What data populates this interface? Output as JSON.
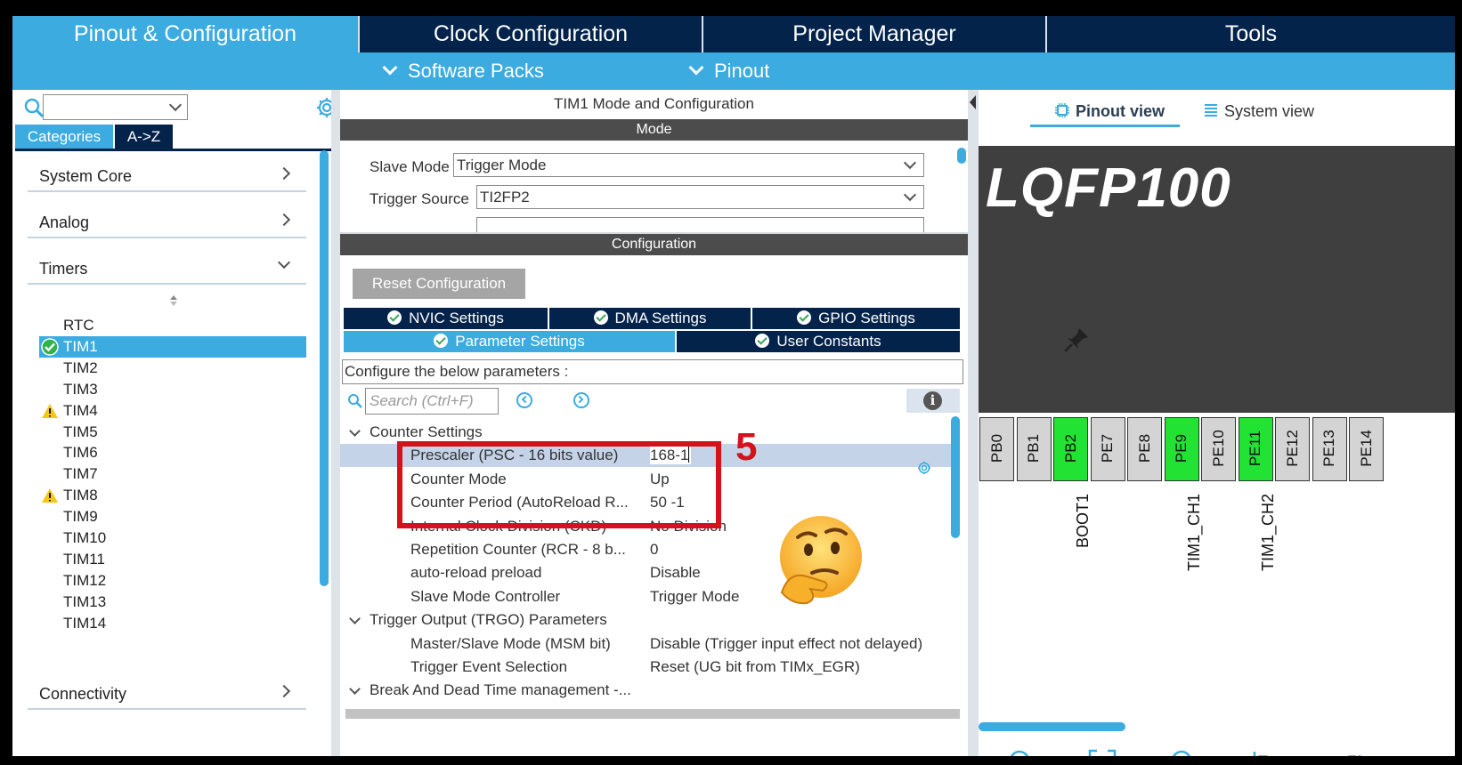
{
  "tabs": {
    "pinout_config": "Pinout & Configuration",
    "clock_config": "Clock Configuration",
    "project_manager": "Project Manager",
    "tools": "Tools"
  },
  "subbar": {
    "software_packs": "Software Packs",
    "pinout": "Pinout"
  },
  "left": {
    "search_value": "",
    "categories_tab": "Categories",
    "az_tab": "A->Z",
    "categories": [
      "System Core",
      "Analog",
      "Timers",
      "Connectivity"
    ],
    "timers": [
      {
        "label": "RTC",
        "status": "none"
      },
      {
        "label": "TIM1",
        "status": "ok",
        "selected": true
      },
      {
        "label": "TIM2",
        "status": "none"
      },
      {
        "label": "TIM3",
        "status": "none"
      },
      {
        "label": "TIM4",
        "status": "warning"
      },
      {
        "label": "TIM5",
        "status": "none"
      },
      {
        "label": "TIM6",
        "status": "none"
      },
      {
        "label": "TIM7",
        "status": "none"
      },
      {
        "label": "TIM8",
        "status": "warning"
      },
      {
        "label": "TIM9",
        "status": "none"
      },
      {
        "label": "TIM10",
        "status": "none"
      },
      {
        "label": "TIM11",
        "status": "none"
      },
      {
        "label": "TIM12",
        "status": "none"
      },
      {
        "label": "TIM13",
        "status": "none"
      },
      {
        "label": "TIM14",
        "status": "none"
      }
    ]
  },
  "middle": {
    "title": "TIM1 Mode and Configuration",
    "mode_header": "Mode",
    "slave_mode_label": "Slave Mode",
    "slave_mode_value": "Trigger Mode",
    "trigger_source_label": "Trigger Source",
    "trigger_source_value": "TI2FP2",
    "config_header": "Configuration",
    "reset_button": "Reset Configuration",
    "tabs_row1": [
      "NVIC Settings",
      "DMA Settings",
      "GPIO Settings"
    ],
    "tabs_row2": [
      "Parameter Settings",
      "User Constants"
    ],
    "configure_text": "Configure the below parameters :",
    "search_placeholder": "Search (Ctrl+F)",
    "rows": [
      {
        "type": "header",
        "key": "Counter Settings"
      },
      {
        "key": "Prescaler (PSC - 16 bits value)",
        "value": "168-1",
        "selected": true
      },
      {
        "key": "Counter Mode",
        "value": "Up"
      },
      {
        "key": "Counter Period (AutoReload R...",
        "value": "50 -1"
      },
      {
        "key": "Internal Clock Division (CKD)",
        "value": "No Division"
      },
      {
        "key": "Repetition Counter (RCR - 8 b...",
        "value": "0"
      },
      {
        "key": "auto-reload preload",
        "value": "Disable"
      },
      {
        "key": "Slave Mode Controller",
        "value": "Trigger Mode"
      },
      {
        "type": "header",
        "key": "Trigger Output (TRGO) Parameters"
      },
      {
        "key": "Master/Slave Mode (MSM bit)",
        "value": "Disable (Trigger input effect not delayed)"
      },
      {
        "key": "Trigger Event Selection",
        "value": "Reset (UG bit from TIMx_EGR)"
      },
      {
        "type": "header",
        "key": "Break And Dead Time management -..."
      }
    ]
  },
  "annotation": {
    "step": "5"
  },
  "right": {
    "pinout_view": "Pinout view",
    "system_view": "System view",
    "chip_name": "LQFP100",
    "pins": [
      {
        "name": "PB0",
        "active": false
      },
      {
        "name": "PB1",
        "active": false
      },
      {
        "name": "PB2",
        "active": true
      },
      {
        "name": "PE7",
        "active": false
      },
      {
        "name": "PE8",
        "active": false
      },
      {
        "name": "PE9",
        "active": true
      },
      {
        "name": "PE10",
        "active": false
      },
      {
        "name": "PE11",
        "active": true
      },
      {
        "name": "PE12",
        "active": false
      },
      {
        "name": "PE13",
        "active": false
      },
      {
        "name": "PE14",
        "active": false
      }
    ],
    "pin_labels": [
      "BOOT1",
      "TIM1_CH1",
      "TIM1_CH2"
    ]
  },
  "colors": {
    "accent": "#3babe0",
    "dark": "#03234b",
    "pin_active": "#22e233",
    "annotation_red": "#d3121c"
  }
}
